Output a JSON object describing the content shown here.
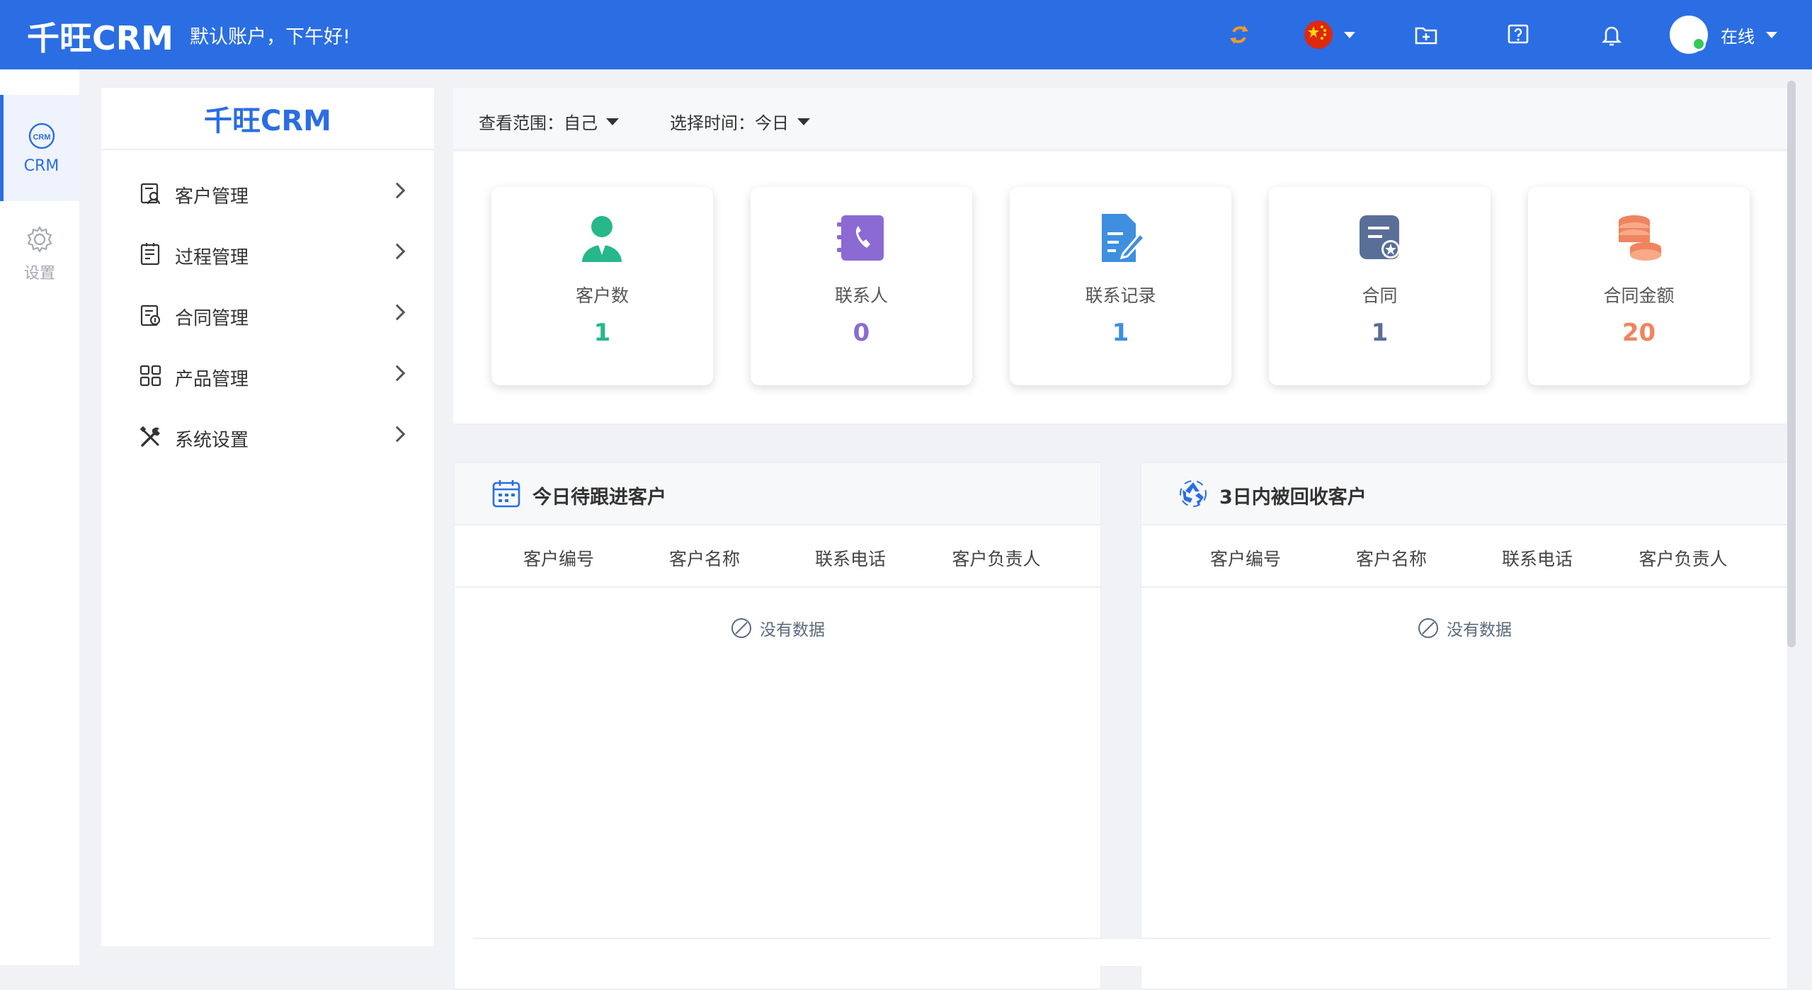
{
  "app": {
    "brand": "千旺CRM",
    "greeting": "默认账户，下午好!",
    "status": "在线"
  },
  "rail": {
    "items": [
      {
        "label": "CRM",
        "icon": "crm-icon",
        "active": true
      },
      {
        "label": "设置",
        "icon": "gear-icon",
        "active": false
      }
    ]
  },
  "menu": {
    "brand": "千旺CRM",
    "items": [
      {
        "label": "客户管理",
        "icon": "customer-manage-icon"
      },
      {
        "label": "过程管理",
        "icon": "process-manage-icon"
      },
      {
        "label": "合同管理",
        "icon": "contract-manage-icon"
      },
      {
        "label": "产品管理",
        "icon": "product-manage-icon"
      },
      {
        "label": "系统设置",
        "icon": "tools-icon"
      }
    ]
  },
  "filters": {
    "scope_label": "查看范围：",
    "scope_value": "自己",
    "time_label": "选择时间：",
    "time_value": "今日"
  },
  "stats": [
    {
      "label": "客户数",
      "value": "1",
      "color": "#26b78a",
      "icon": "customer-icon"
    },
    {
      "label": "联系人",
      "value": "0",
      "color": "#8c6ad3",
      "icon": "contact-book-icon"
    },
    {
      "label": "联系记录",
      "value": "1",
      "color": "#3f8fe0",
      "icon": "record-edit-icon"
    },
    {
      "label": "合同",
      "value": "1",
      "color": "#5a6f98",
      "icon": "contract-icon"
    },
    {
      "label": "合同金额",
      "value": "20",
      "color": "#f0845f",
      "icon": "coins-icon"
    }
  ],
  "panels": [
    {
      "title": "今日待跟进客户",
      "icon": "calendar-icon",
      "columns": [
        "客户编号",
        "客户名称",
        "联系电话",
        "客户负责人"
      ],
      "empty": "没有数据"
    },
    {
      "title": "3日内被回收客户",
      "icon": "recycle-icon",
      "columns": [
        "客户编号",
        "客户名称",
        "联系电话",
        "客户负责人"
      ],
      "empty": "没有数据"
    }
  ],
  "colors": {
    "primary": "#2b6de3",
    "online": "#35c759"
  }
}
